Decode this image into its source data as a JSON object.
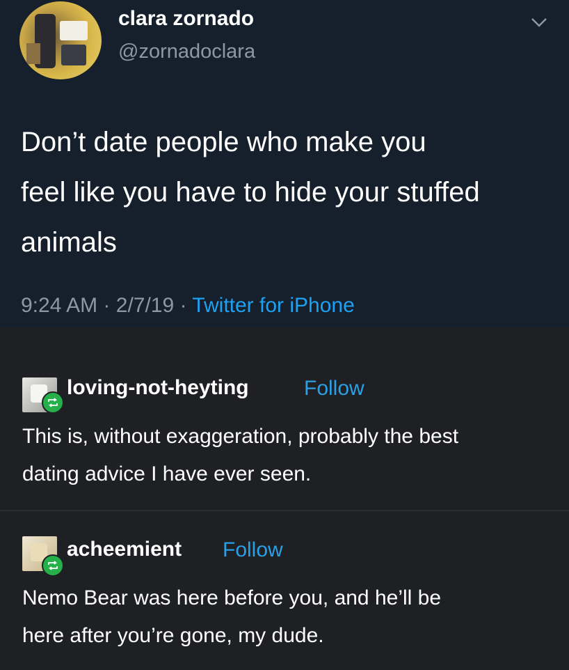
{
  "tweet": {
    "display_name": "clara zornado",
    "handle": "@zornadoclara",
    "text_lines": [
      "Don’t date people who make you",
      "feel like you have to hide your stuffed",
      "animals"
    ],
    "time": "9:24 AM",
    "date": "2/7/19",
    "separator": "·",
    "source": "Twitter for iPhone",
    "menu_icon": "chevron-down-icon"
  },
  "reblogs": [
    {
      "username": "loving-not-heyting",
      "follow_label": "Follow",
      "text_lines": [
        "This is, without exaggeration, probably the best",
        "dating advice I have ever seen."
      ]
    },
    {
      "username": "acheemient",
      "follow_label": "Follow",
      "text_lines": [
        "Nemo Bear was here before you, and he’ll be",
        "here after you’re gone, my dude."
      ]
    }
  ],
  "colors": {
    "tweet_bg": "#16202c",
    "reblog_bg": "#1f2023",
    "link": "#1da1f2",
    "follow": "#2aa0e6",
    "reblog_badge": "#26b04a"
  }
}
